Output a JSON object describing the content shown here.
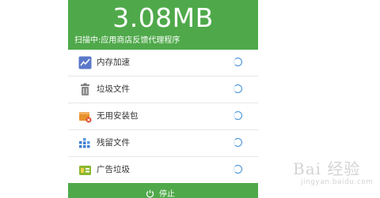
{
  "header": {
    "size_value": "3.08MB",
    "scan_status": "扫描中:应用商店反馈代理程序",
    "background_color": "#4fa94a"
  },
  "scan_items": [
    {
      "label": "内存加速",
      "icon": "trend-chart-icon",
      "status": "scanning"
    },
    {
      "label": "垃圾文件",
      "icon": "trash-can-icon",
      "status": "scanning"
    },
    {
      "label": "无用安装包",
      "icon": "package-box-icon",
      "status": "scanning"
    },
    {
      "label": "残留文件",
      "icon": "file-grid-icon",
      "status": "scanning"
    },
    {
      "label": "广告垃圾",
      "icon": "ad-android-icon",
      "status": "scanning"
    }
  ],
  "footer": {
    "stop_label": "停止",
    "stop_icon": "power-icon"
  },
  "watermark": {
    "text": "Bai 经验",
    "subtext": "jingyan.baidu.com"
  },
  "colors": {
    "accent_green": "#4fa94a",
    "spinner_blue": "#3d8fd8"
  }
}
